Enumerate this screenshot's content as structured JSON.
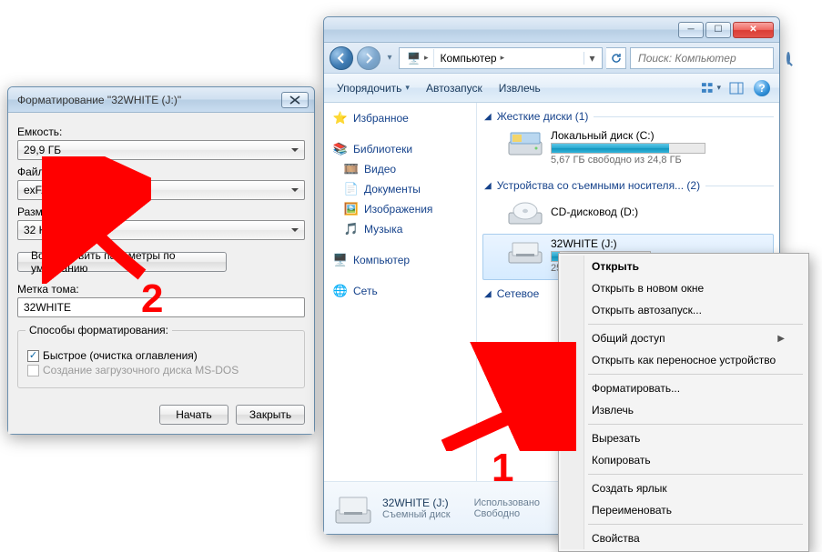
{
  "format_dialog": {
    "title": "Форматирование \"32WHITE (J:)\"",
    "capacity_label": "Емкость:",
    "capacity_value": "29,9 ГБ",
    "fs_label": "Файловая система:",
    "fs_value": "exFAT",
    "cluster_label": "Размер кластера:",
    "cluster_value": "32 КБ",
    "restore_defaults": "Восстановить параметры по умолчанию",
    "volume_label_label": "Метка тома:",
    "volume_label_value": "32WHITE",
    "options_group": "Способы форматирования:",
    "quick_format": "Быстрое (очистка оглавления)",
    "msdos_boot": "Создание загрузочного диска MS-DOS",
    "start": "Начать",
    "close": "Закрыть"
  },
  "explorer": {
    "breadcrumb_root": "Компьютер",
    "search_placeholder": "Поиск: Компьютер",
    "toolbar": {
      "organize": "Упорядочить",
      "autoplay": "Автозапуск",
      "eject": "Извлечь"
    },
    "navpane": {
      "favorites": "Избранное",
      "libraries": "Библиотеки",
      "videos": "Видео",
      "documents": "Документы",
      "images": "Изображения",
      "music": "Музыка",
      "computer": "Компьютер",
      "network": "Сеть"
    },
    "groups": {
      "hard_drives": "Жесткие диски (1)",
      "removable": "Устройства со съемными носителя... (2)",
      "network_loc": "Сетевое "
    },
    "drive_c": {
      "name": "Локальный диск (C:)",
      "sub": "5,67 ГБ свободно из 24,8 ГБ",
      "used_pct": 77
    },
    "drive_d": {
      "name": "CD-дисковод (D:)"
    },
    "drive_j": {
      "name": "32WHITE (J:)",
      "sub": "25",
      "used_pct": 8
    },
    "details": {
      "title": "32WHITE (J:)",
      "subtitle": "Съемный диск",
      "col1": "Использовано",
      "col2": "Свободно"
    }
  },
  "context_menu": {
    "open": "Открыть",
    "open_new": "Открыть в новом окне",
    "open_autoplay": "Открыть автозапуск...",
    "share": "Общий доступ",
    "open_portable": "Открыть как переносное устройство",
    "format": "Форматировать...",
    "eject": "Извлечь",
    "cut": "Вырезать",
    "copy": "Копировать",
    "shortcut": "Создать ярлык",
    "rename": "Переименовать",
    "properties": "Свойства"
  },
  "annotations": {
    "one": "1",
    "two": "2"
  }
}
